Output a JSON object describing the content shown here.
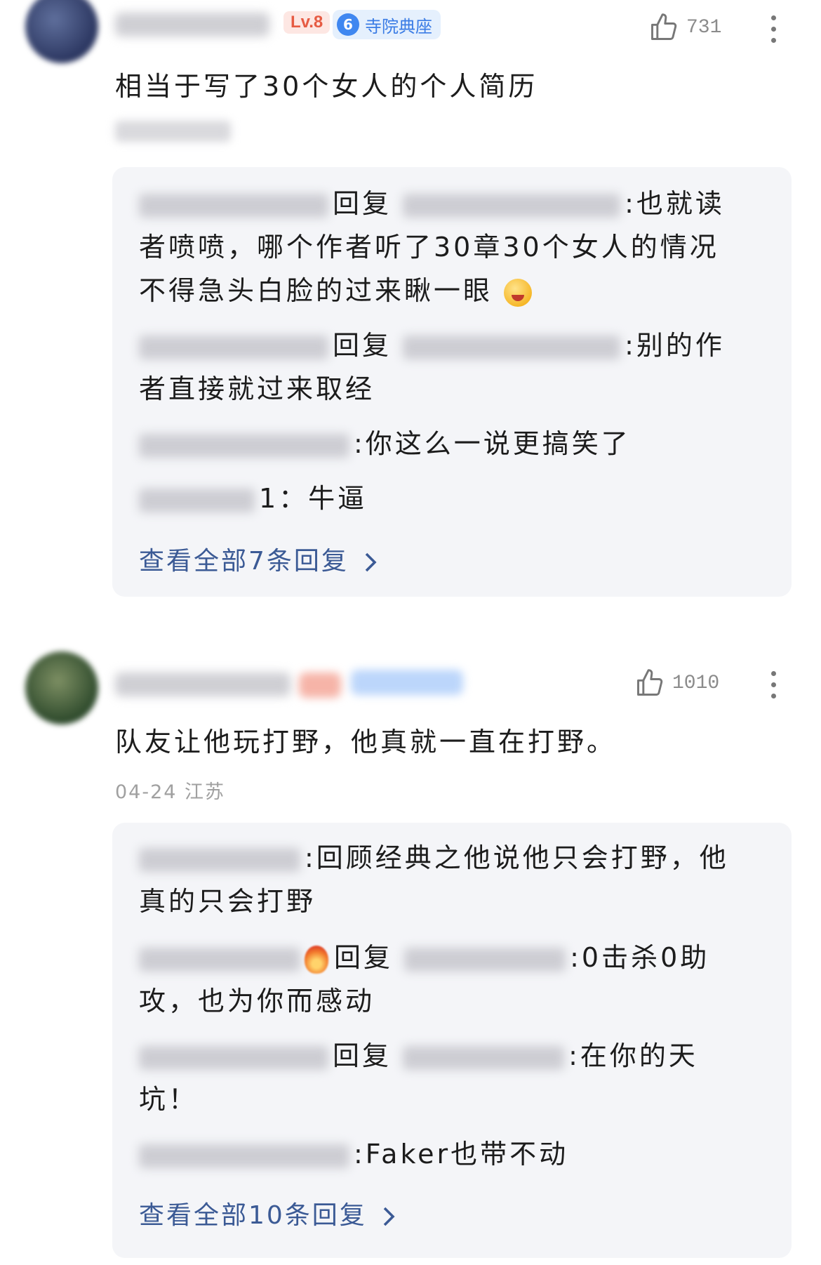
{
  "comments": [
    {
      "level": "Lv.8",
      "fan_badge": {
        "number": "6",
        "label": "寺院典座"
      },
      "likes": "731",
      "text": "相当于写了30个女人的个人简历",
      "replies": [
        {
          "verb": "回复",
          "text": ":也就读",
          "text2": "者喷喷，哪个作者听了30章30个女人的情况",
          "text3": "不得急头白脸的过来瞅一眼"
        },
        {
          "verb": "回复",
          "text": ":别的作",
          "text2": "者直接就过来取经"
        },
        {
          "text": ":你这么一说更搞笑了"
        },
        {
          "text": "1：牛逼"
        }
      ],
      "view_all": "查看全部7条回复"
    },
    {
      "likes": "1010",
      "text": "队友让他玩打野，他真就一直在打野。",
      "meta": "04-24 江苏",
      "replies": [
        {
          "text": ":回顾经典之他说他只会打野，他",
          "text2": "真的只会打野"
        },
        {
          "verb": "回复",
          "text": ":0击杀0助",
          "text2": "攻，也为你而感动"
        },
        {
          "verb": "回复",
          "text": ":在你的天",
          "text2": "坑！"
        },
        {
          "text": ":Faker也带不动"
        }
      ],
      "view_all": "查看全部10条回复"
    }
  ],
  "icons": {
    "like": "thumbs-up-icon",
    "more": "more-vertical-icon",
    "chevron": "chevron-right-icon"
  },
  "colors": {
    "link": "#3b5a95",
    "level": "#e65b43",
    "fan": "#3a7ce5"
  }
}
